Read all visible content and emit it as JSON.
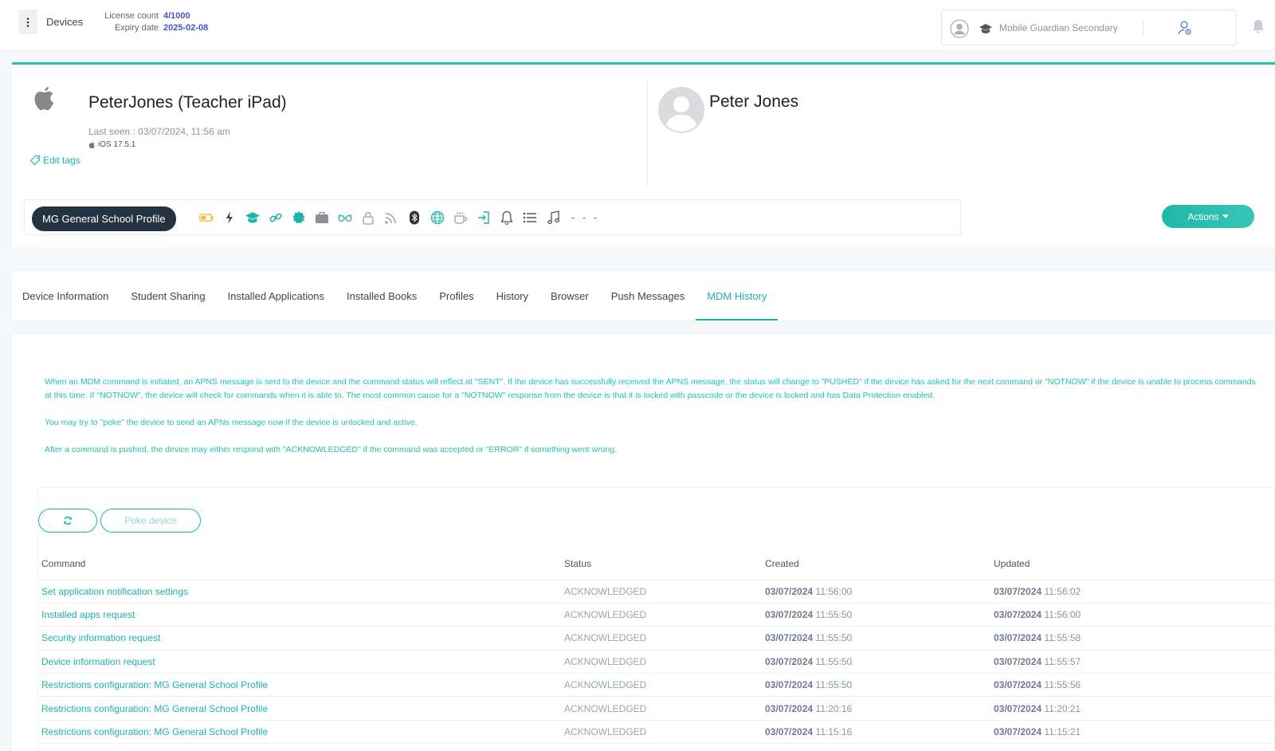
{
  "header": {
    "devices_label": "Devices",
    "license_count_label": "License count",
    "license_count_value": "4/1000",
    "expiry_label": "Expiry date",
    "expiry_value": "2025-02-08",
    "school_name": "Mobile Guardian Secondary"
  },
  "device": {
    "title": "PeterJones (Teacher iPad)",
    "last_seen": "Last seen : 03/07/2024, 11:56 am",
    "os_version": "iOS 17.5.1",
    "edit_tags": "Edit tags",
    "user_name": "Peter Jones",
    "profile_name": "MG General School Profile",
    "status_dashes": "- - -",
    "actions_label": "Actions"
  },
  "status_icons": [
    "battery-icon",
    "charging-icon",
    "graduation-cap-icon",
    "link-icon",
    "badge-icon",
    "briefcase-icon",
    "glasses-icon",
    "lock-icon",
    "rss-icon",
    "bluetooth-icon",
    "globe-icon",
    "coffee-icon",
    "sign-in-icon",
    "bell-icon",
    "list-icon",
    "music-icon"
  ],
  "tabs": [
    "Device Information",
    "Student Sharing",
    "Installed Applications",
    "Installed Books",
    "Profiles",
    "History",
    "Browser",
    "Push Messages",
    "MDM History"
  ],
  "active_tab": "MDM History",
  "info": {
    "p1": "When an MDM command is initiated, an APNS message is sent to the device and the command status will reflect at \"SENT\". If the device has successfully received the APNS message, the status will change to \"PUSHED\" if the device has asked for the next command or \"NOTNOW\" if the device is unable to process commands at this time. If \"NOTNOW\", the device will check for commands when it is able to. The most common cause for a \"NOTNOW\" response from the device is that it is locked with passcode or the device is locked and has Data Protection enabled.",
    "p2": "You may try to \"poke\" the device to send an APNs message now if the device is unlocked and active.",
    "p3": "After a command is pushed, the device may either respond with \"ACKNOWLEDGED\" if the command was accepted or \"ERROR\" if something went wrong."
  },
  "history": {
    "poke_label": "Poke device",
    "columns": {
      "command": "Command",
      "status": "Status",
      "created": "Created",
      "updated": "Updated"
    },
    "rows": [
      {
        "command": "Set application notification settings",
        "status": "ACKNOWLEDGED",
        "created_date": "03/07/2024",
        "created_time": "11:56:00",
        "updated_date": "03/07/2024",
        "updated_time": "11:56:02"
      },
      {
        "command": "Installed apps request",
        "status": "ACKNOWLEDGED",
        "created_date": "03/07/2024",
        "created_time": "11:55:50",
        "updated_date": "03/07/2024",
        "updated_time": "11:56:00"
      },
      {
        "command": "Security information request",
        "status": "ACKNOWLEDGED",
        "created_date": "03/07/2024",
        "created_time": "11:55:50",
        "updated_date": "03/07/2024",
        "updated_time": "11:55:58"
      },
      {
        "command": "Device information request",
        "status": "ACKNOWLEDGED",
        "created_date": "03/07/2024",
        "created_time": "11:55:50",
        "updated_date": "03/07/2024",
        "updated_time": "11:55:57"
      },
      {
        "command": "Restrictions configuration: MG General School Profile",
        "status": "ACKNOWLEDGED",
        "created_date": "03/07/2024",
        "created_time": "11:55:50",
        "updated_date": "03/07/2024",
        "updated_time": "11:55:56"
      },
      {
        "command": "Restrictions configuration: MG General School Profile",
        "status": "ACKNOWLEDGED",
        "created_date": "03/07/2024",
        "created_time": "11:20:16",
        "updated_date": "03/07/2024",
        "updated_time": "11:20:21"
      },
      {
        "command": "Restrictions configuration: MG General School Profile",
        "status": "ACKNOWLEDGED",
        "created_date": "03/07/2024",
        "created_time": "11:15:16",
        "updated_date": "03/07/2024",
        "updated_time": "11:15:21"
      }
    ]
  },
  "colors": {
    "accent": "#1fb4a7",
    "link_blue": "#4453d1",
    "pill_dark": "#243241"
  }
}
